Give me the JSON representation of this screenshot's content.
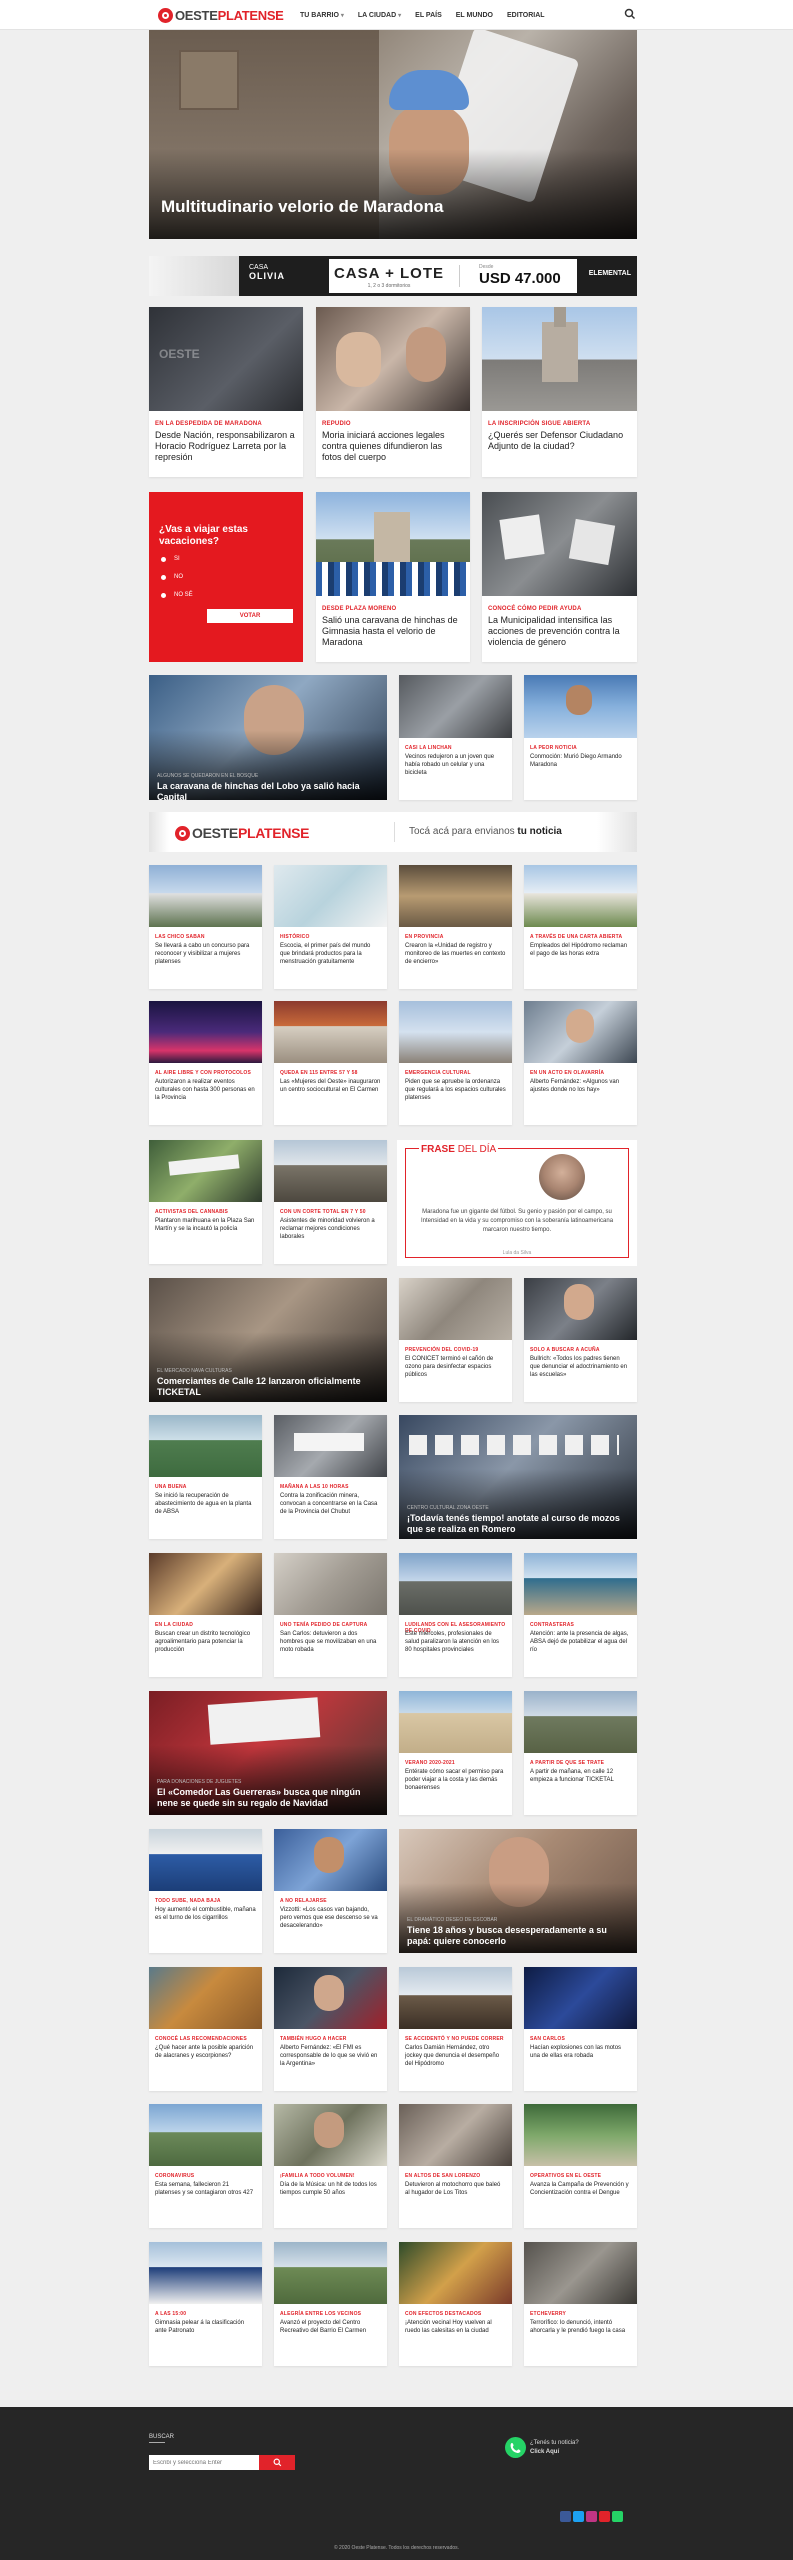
{
  "nav": {
    "logo_a": "OESTE",
    "logo_b": "PLATENSE",
    "items": [
      "TU BARRIO",
      "LA CIUDAD",
      "EL PAÍS",
      "EL MUNDO",
      "EDITORIAL"
    ]
  },
  "hero": {
    "title": "Multitudinario velorio de Maradona"
  },
  "banner": {
    "brand_a": "CASA",
    "brand_b": "OLIVIA",
    "title": "CASA + LOTE",
    "sub": "1, 2 o 3 dormitorios",
    "price_label": "Desde",
    "price": "USD 47.000",
    "logo": "ELEMENTAL"
  },
  "row1": [
    {
      "kicker": "EN LA DESPEDIDA DE MARADONA",
      "title": "Desde Nación, responsabilizaron a Horacio Rodríguez Larreta por la represión"
    },
    {
      "kicker": "REPUDIO",
      "title": "Moria iniciará acciones legales contra quienes difundieron las fotos del cuerpo"
    },
    {
      "kicker": "LA INSCRIPCIÓN SIGUE ABIERTA",
      "title": "¿Querés ser Defensor Ciudadano Adjunto de la ciudad?"
    }
  ],
  "poll": {
    "title": "¿Vas a viajar estas vacaciones?",
    "options": [
      "SI",
      "NO",
      "NO SÉ"
    ],
    "button": "VOTAR"
  },
  "row2": [
    {
      "kicker": "DESDE PLAZA MORENO",
      "title": "Salió una caravana de hinchas de Gimnasia hasta el velorio de Maradona"
    },
    {
      "kicker": "CONOCÉ CÓMO PEDIR AYUDA",
      "title": "La Municipalidad intensifica las acciones de prevención contra la violencia de género"
    }
  ],
  "row3": {
    "dark": {
      "kicker": "ALGUNOS SE QUEDARON EN EL BOSQUE",
      "title": "La caravana de hinchas del Lobo ya salió hacia Capital"
    },
    "cards": [
      {
        "kicker": "CASI LA LINCHAN",
        "title": "Vecinos redujeron a un joven que había robado un celular y una bicicleta"
      },
      {
        "kicker": "LA PEOR NOTICIA",
        "title": "Conmoción: Murió Diego Armando Maradona"
      }
    ]
  },
  "contact": {
    "logo_a": "OESTE",
    "logo_b": "PLATENSE",
    "cta_a": "Tocá acá para envianos",
    "cta_b": "tu noticia"
  },
  "grid1": [
    {
      "kicker": "LAS CHICO SABAN",
      "title": "Se llevará a cabo un concurso para reconocer y visibilizar a mujeres platenses"
    },
    {
      "kicker": "HISTÓRICO",
      "title": "Escocia, el primer país del mundo que brindará productos para la menstruación gratuitamente"
    },
    {
      "kicker": "EN PROVINCIA",
      "title": "Crearon la «Unidad de registro y monitoreo de las muertes en contexto de encierro»"
    },
    {
      "kicker": "A TRAVÉS DE UNA CARTA ABIERTA",
      "title": "Empleados del Hipódromo reclaman el pago de las horas extra"
    }
  ],
  "grid2": [
    {
      "kicker": "AL AIRE LIBRE Y CON PROTOCOLOS",
      "title": "Autorizaron a realizar eventos culturales con hasta 300 personas en la Provincia"
    },
    {
      "kicker": "QUEDA EN 115 ENTRE 57 Y 58",
      "title": "Las «Mujeres del Oeste» inauguraron un centro sociocultural en El Carmen"
    },
    {
      "kicker": "EMERGENCIA CULTURAL",
      "title": "Piden que se apruebe la ordenanza que regulará a los espacios culturales platenses"
    },
    {
      "kicker": "EN UN ACTO EN OLAVARRÍA",
      "title": "Alberto Fernández: «Algunos van ajustes donde no los hay»"
    }
  ],
  "grid3": [
    {
      "kicker": "ACTIVISTAS DEL CANNABIS",
      "title": "Plantaron marihuana en la Plaza San Martín y se la incautó la policía"
    },
    {
      "kicker": "CON UN CORTE TOTAL EN 7 Y 50",
      "title": "Asistentes de minoridad volvieron a reclamar mejores condiciones laborales"
    }
  ],
  "quote": {
    "title_a": "FRASE",
    "title_b": "DEL DÍA",
    "text": "Maradona fue un gigante del fútbol. Su genio y pasión por el campo, su Intensidad en la vida y su compromiso con la soberanía latinoamericana marcaron nuestro tiempo.",
    "author": "Lula da Silva"
  },
  "row4": {
    "dark": {
      "kicker": "EL MERCADO NAVA CULTURAS",
      "title": "Comerciantes de Calle 12 lanzaron oficialmente TICKETAL"
    },
    "cards": [
      {
        "kicker": "PREVENCIÓN DEL COVID-19",
        "title": "El CONICET terminó el cañón de ozono para desinfectar espacios públicos"
      },
      {
        "kicker": "SOLO A BUSCAR A ACUÑA",
        "title": "Bullrich: «Todos los padres tienen que denunciar el adoctrinamiento en las escuelas»"
      }
    ]
  },
  "row5": {
    "cards": [
      {
        "kicker": "UNA BUENA",
        "title": "Se inició la recuperación de abastecimiento de agua en la planta de ABSA"
      },
      {
        "kicker": "MAÑANA A LAS 10 HORAS",
        "title": "Contra la zonificación minera, convocan a concentrarse en la Casa de la Provincia del Chubut"
      }
    ],
    "dark": {
      "kicker": "CENTRO CULTURAL ZONA OESTE",
      "title": "¡Todavía tenés tiempo! anotate al curso de mozos que se realiza en Romero"
    }
  },
  "grid6": [
    {
      "kicker": "EN LA CIUDAD",
      "title": "Buscan crear un distrito tecnológico agroalimentario para potenciar la producción"
    },
    {
      "kicker": "UNO TENÍA PEDIDO DE CAPTURA",
      "title": "San Carlos: detuvieron a dos hombres que se movilizaban en una moto robada"
    },
    {
      "kicker": "LUDILANDS CON EL ASESORAMIENTO DE COVID",
      "title": "Este miércoles, profesionales de salud paralizaron la atención en los 80 hospitales provinciales"
    },
    {
      "kicker": "CONTRASTERAS",
      "title": "Atención: ante la presencia de algas, ABSA dejó de potabilizar el agua del río"
    }
  ],
  "row7": {
    "dark": {
      "kicker": "PARA DONACIONES DE JUGUETES",
      "title": "El «Comedor Las Guerreras» busca que ningún nene se quede sin su regalo de Navidad"
    },
    "cards": [
      {
        "kicker": "VERANO 2020-2021",
        "title": "Entérate cómo sacar el permiso para poder viajar a la costa y las demás bonaerenses"
      },
      {
        "kicker": "A PARTIR DE QUE SE TRATE",
        "title": "A partir de mañana, en calle 12 empieza a funcionar TICKETAL"
      }
    ]
  },
  "row8": {
    "cards": [
      {
        "kicker": "TODO SUBE, NADA BAJA",
        "title": "Hoy aumentó el combustible, mañana es el turno de los cigarrillos"
      },
      {
        "kicker": "A NO RELAJARSE",
        "title": "Vizzotti: «Los casos van bajando, pero vemos que ese descenso se va desacelerando»"
      }
    ],
    "dark": {
      "kicker": "EL DRAMÁTICO DESEO DE ESCOBAR",
      "title": "Tiene 18 años y busca desesperadamente a su papá: quiere conocerlo"
    }
  },
  "grid9": [
    {
      "kicker": "CONOCÉ LAS RECOMENDACIONES",
      "title": "¿Qué hacer ante la posible aparición de alacranes y escorpiones?"
    },
    {
      "kicker": "TAMBIÉN HUGO A HACER",
      "title": "Alberto Fernández: «El FMI es corresponsable de lo que se vivió en la Argentina»"
    },
    {
      "kicker": "SE ACCIDENTÓ Y NO PUEDE CORRER",
      "title": "Carlos Damián Hernández, otro jockey que denuncia el desempeño del Hipódromo"
    },
    {
      "kicker": "SAN CARLOS",
      "title": "Hacían explosiones con las motos una de ellas era robada"
    }
  ],
  "grid10": [
    {
      "kicker": "CORONAVIRUS",
      "title": "Esta semana, fallecieron 21 platenses y se contagiaron otros 427"
    },
    {
      "kicker": "¡FAMILIA A TODO VOLUMEN!",
      "title": "Día de la Música: un hit de todos los tiempos cumple 50 años"
    },
    {
      "kicker": "EN ALTOS DE SAN LORENZO",
      "title": "Detuvieron al motochorro que baleó al hugador de Los Titos"
    },
    {
      "kicker": "OPERATIVOS EN EL OESTE",
      "title": "Avanza la Campaña de Prevención y Concientización contra el Dengue"
    }
  ],
  "grid11": [
    {
      "kicker": "A LAS 15:00",
      "title": "Gimnasia pelear á la clasificación ante Patronato"
    },
    {
      "kicker": "ALEGRÍA ENTRE LOS VECINOS",
      "title": "Avanzó el proyecto del Centro Recreativo del Barrio El Carmen"
    },
    {
      "kicker": "CON EFECTOS DESTACADOS",
      "title": "¡Atención vecinal Hoy vuelven al ruedo las calesitas en la ciudad"
    },
    {
      "kicker": "ETCHEVERRY",
      "title": "Terrorífico: lo denunció, intentó ahorcarla y le prendió fuego la casa"
    }
  ],
  "footer": {
    "search_label": "BUSCAR",
    "search_placeholder": "Escribí y selecciona Enter",
    "whatsapp_a": "¿Tenés tu noticia?",
    "whatsapp_b": "Click Aquí",
    "copyright": "© 2020 Oeste Platense. Todos los derechos reservados."
  },
  "colors": {
    "brand": "#e1232a",
    "dark": "#333333",
    "footer": "#262626"
  }
}
